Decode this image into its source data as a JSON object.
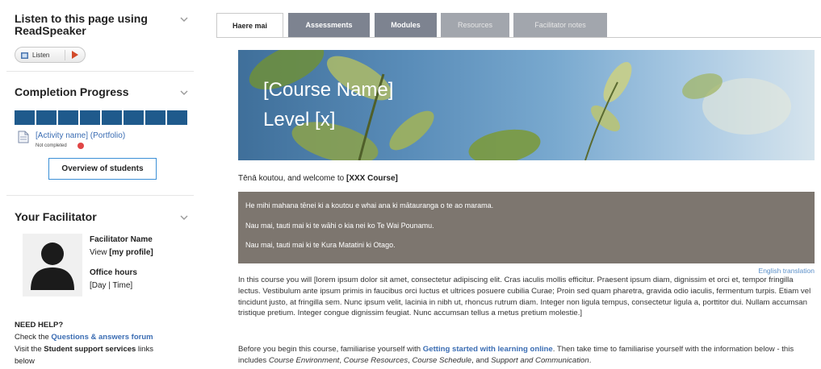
{
  "sidebar": {
    "readspeaker": {
      "title": "Listen to this page using ReadSpeaker",
      "listen_label": "Listen"
    },
    "completion": {
      "title": "Completion Progress",
      "segments": 8,
      "activity_link": "[Activity name] (Portfolio)",
      "activity_status": "Not completed",
      "overview_button": "Overview of students"
    },
    "facilitator": {
      "title": "Your Facilitator",
      "name": "Facilitator Name",
      "view_prefix": "View ",
      "view_link": "[my profile]",
      "office_label": "Office hours",
      "office_value": "[Day | Time]"
    },
    "help": {
      "heading": "NEED HELP?",
      "line1_prefix": "Check the ",
      "line1_link": "Questions & answers forum",
      "line2_prefix": "Visit the ",
      "line2_bold": "Student support services",
      "line2_suffix": " links",
      "line3": "below"
    }
  },
  "tabs": [
    {
      "label": "Haere mai",
      "state": "active"
    },
    {
      "label": "Assessments",
      "state": "normal"
    },
    {
      "label": "Modules",
      "state": "normal"
    },
    {
      "label": "Resources",
      "state": "muted"
    },
    {
      "label": "Facilitator notes",
      "state": "muted"
    }
  ],
  "banner": {
    "course_name": "[Course Name]",
    "level": "Level [x]"
  },
  "main": {
    "greeting_prefix": "Tēnā koutou, and welcome to ",
    "greeting_course": "[XXX Course]",
    "maori_lines": [
      "He mihi mahana tēnei ki a koutou e whai ana ki mātauranga o te ao marama.",
      "Nau mai, tauti mai ki te wāhi o kia nei ko Te Wai Pounamu.",
      "Nau mai, tauti mai ki te Kura Matatini ki Otago."
    ],
    "translation_link": "English translation",
    "para1": "In this course you will [lorem ipsum dolor sit amet, consectetur adipiscing elit. Cras iaculis mollis efficitur. Praesent ipsum diam, dignissim et orci et, tempor fringilla lectus. Vestibulum ante ipsum primis in faucibus orci luctus et ultrices posuere cubilia Curae; Proin sed quam pharetra, gravida odio iaculis, fermentum turpis. Etiam vel tincidunt justo, at fringilla sem. Nunc ipsum velit, lacinia in nibh ut, rhoncus rutrum diam. Integer non ligula tempus, consectetur ligula a, porttitor dui. Nullam accumsan tristique pretium. Integer congue dignissim feugiat. Nunc accumsan tellus a metus pretium molestie.]",
    "para2_prefix": "Before you begin this course, familiarise yourself with ",
    "para2_link": "Getting started with learning online",
    "para2_mid": ". Then take time to familiarise yourself with the information below - this includes ",
    "para2_item1": "Course Environment",
    "para2_sep1": ", ",
    "para2_item2": "Course Resources",
    "para2_sep2": ", ",
    "para2_item3": "Course Schedule",
    "para2_sep3": ", and ",
    "para2_item4": "Support and Communication",
    "para2_end": "."
  },
  "colors": {
    "progress": "#1f5a8c",
    "tab_normal": "#7d8390",
    "tab_muted": "#a2a6ad",
    "maori_box": "#7d766f",
    "link": "#3b6db3"
  },
  "icons": [
    "chevron-down-icon",
    "speaker-icon",
    "play-icon",
    "document-icon",
    "status-dot-icon",
    "user-avatar-icon"
  ]
}
